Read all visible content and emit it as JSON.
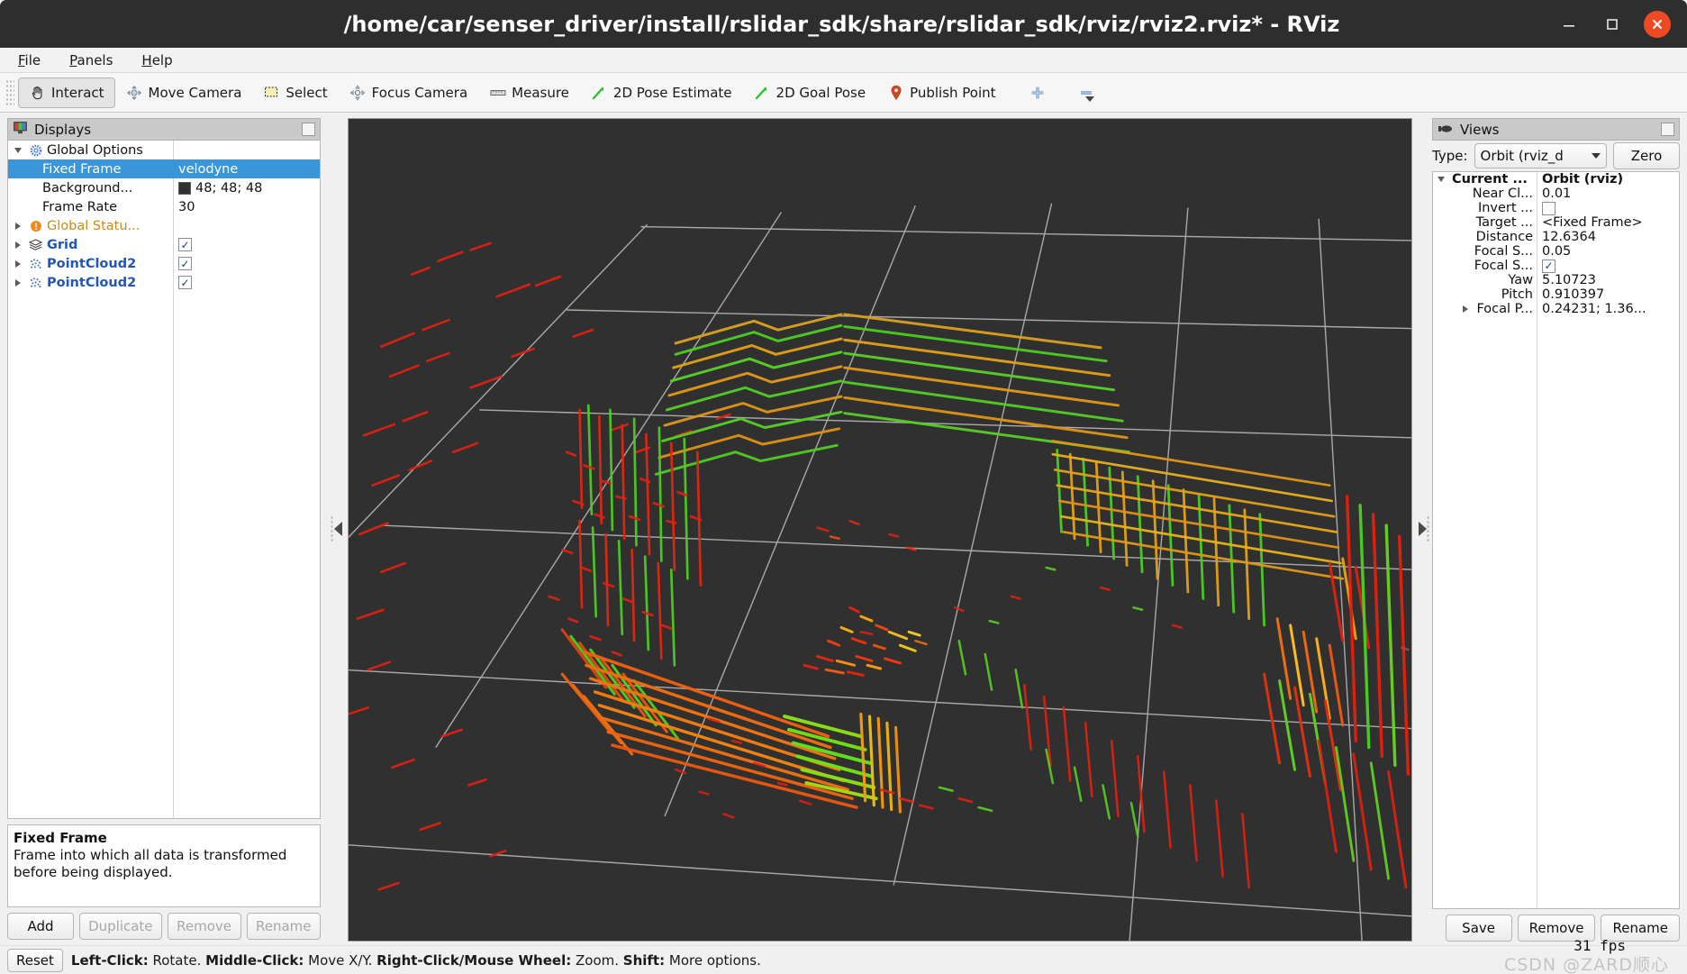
{
  "window": {
    "title": "/home/car/senser_driver/install/rslidar_sdk/share/rslidar_sdk/rviz/rviz2.rviz* - RViz",
    "minimize_label": "minimize-icon",
    "maximize_label": "maximize-icon",
    "close_label": "close-icon"
  },
  "menubar": {
    "items": [
      {
        "label": "File",
        "mnemonic": "F"
      },
      {
        "label": "Panels",
        "mnemonic": "P"
      },
      {
        "label": "Help",
        "mnemonic": "H"
      }
    ]
  },
  "toolbar": {
    "buttons": [
      {
        "label": "Interact",
        "icon": "hand-icon",
        "checked": true
      },
      {
        "label": "Move Camera",
        "icon": "move-camera-icon",
        "checked": false
      },
      {
        "label": "Select",
        "icon": "select-rect-icon",
        "checked": false
      },
      {
        "label": "Focus Camera",
        "icon": "focus-camera-icon",
        "checked": false
      },
      {
        "label": "Measure",
        "icon": "ruler-icon",
        "checked": false
      },
      {
        "label": "2D Pose Estimate",
        "icon": "pose-arrow-icon",
        "checked": false
      },
      {
        "label": "2D Goal Pose",
        "icon": "goal-arrow-icon",
        "checked": false
      },
      {
        "label": "Publish Point",
        "icon": "map-pin-icon",
        "checked": false
      }
    ],
    "add_tool_icon": "plus-icon",
    "remove_tool_icon": "minus-icon"
  },
  "displays_panel": {
    "title": "Displays",
    "title_icon": "monitor-icon",
    "float_button": "float-panel-button",
    "rows": [
      {
        "name": "Global Options",
        "value": "",
        "indent": 0,
        "twisty": "down",
        "icon": "gear-icon",
        "style": "plain",
        "selected": false
      },
      {
        "name": "Fixed Frame",
        "value": "velodyne",
        "indent": 2,
        "twisty": "none",
        "icon": "none",
        "style": "plain",
        "selected": true
      },
      {
        "name": "Background...",
        "value": "48; 48; 48",
        "indent": 2,
        "twisty": "none",
        "icon": "none",
        "style": "plain",
        "selected": false,
        "swatch": "#303030"
      },
      {
        "name": "Frame Rate",
        "value": "30",
        "indent": 2,
        "twisty": "none",
        "icon": "none",
        "style": "plain",
        "selected": false
      },
      {
        "name": "Global Statu...",
        "value": "",
        "indent": 0,
        "twisty": "right",
        "icon": "warning-icon",
        "style": "warn",
        "selected": false
      },
      {
        "name": "Grid",
        "value": "",
        "indent": 0,
        "twisty": "right",
        "icon": "grid-icon",
        "style": "bold-blue",
        "selected": false,
        "checkbox": true
      },
      {
        "name": "PointCloud2",
        "value": "",
        "indent": 0,
        "twisty": "right",
        "icon": "pointcloud-icon",
        "style": "bold-blue",
        "selected": false,
        "checkbox": true
      },
      {
        "name": "PointCloud2",
        "value": "",
        "indent": 0,
        "twisty": "right",
        "icon": "pointcloud-icon",
        "style": "bold-blue",
        "selected": false,
        "checkbox": true
      }
    ],
    "help": {
      "title": "Fixed Frame",
      "body": "Frame into which all data is transformed before being displayed."
    },
    "buttons": [
      {
        "label": "Add",
        "enabled": true
      },
      {
        "label": "Duplicate",
        "enabled": false
      },
      {
        "label": "Remove",
        "enabled": false
      },
      {
        "label": "Rename",
        "enabled": false
      }
    ]
  },
  "views_panel": {
    "title": "Views",
    "title_icon": "camera-icon",
    "float_button": "float-panel-button",
    "type_label": "Type:",
    "type_value": "Orbit (rviz_d",
    "zero_button": "Zero",
    "rows": [
      {
        "name": "Current ...",
        "value": "Orbit (rviz)",
        "twisty": "down",
        "bold": true,
        "align": "left"
      },
      {
        "name": "Near Cl...",
        "value": "0.01",
        "twisty": "none",
        "bold": false
      },
      {
        "name": "Invert ...",
        "value": "",
        "twisty": "none",
        "bold": false,
        "checkbox": false
      },
      {
        "name": "Target ...",
        "value": "<Fixed Frame>",
        "twisty": "none",
        "bold": false
      },
      {
        "name": "Distance",
        "value": "12.6364",
        "twisty": "none",
        "bold": false
      },
      {
        "name": "Focal S...",
        "value": "0.05",
        "twisty": "none",
        "bold": false
      },
      {
        "name": "Focal S...",
        "value": "",
        "twisty": "none",
        "bold": false,
        "checkbox": true
      },
      {
        "name": "Yaw",
        "value": "5.10723",
        "twisty": "none",
        "bold": false
      },
      {
        "name": "Pitch",
        "value": "0.910397",
        "twisty": "none",
        "bold": false
      },
      {
        "name": "Focal P...",
        "value": "0.24231; 1.36...",
        "twisty": "right",
        "bold": false
      }
    ],
    "buttons": [
      {
        "label": "Save",
        "enabled": true
      },
      {
        "label": "Remove",
        "enabled": true
      },
      {
        "label": "Rename",
        "enabled": true
      }
    ]
  },
  "splitters": {
    "left_collapse_icon": "collapse-left-arrow",
    "right_collapse_icon": "collapse-right-arrow"
  },
  "statusbar": {
    "reset_button": "Reset",
    "hint_parts": [
      {
        "text": "Left-Click:",
        "bold": true
      },
      {
        "text": " Rotate. ",
        "bold": false
      },
      {
        "text": "Middle-Click:",
        "bold": true
      },
      {
        "text": " Move X/Y. ",
        "bold": false
      },
      {
        "text": "Right-Click/Mouse Wheel:",
        "bold": true
      },
      {
        "text": " Zoom. ",
        "bold": false
      },
      {
        "text": "Shift:",
        "bold": true
      },
      {
        "text": " More options.",
        "bold": false
      }
    ],
    "fps": "31 fps",
    "watermark": "CSDN @ZARD顺心"
  },
  "viewport": {
    "background_color": "#303030",
    "grid_color": "#b4b4b4",
    "fixed_frame": "velodyne",
    "point_colors": {
      "near": "#ff1a00",
      "mid": "#ffaa00",
      "far": "#33dd22"
    }
  }
}
